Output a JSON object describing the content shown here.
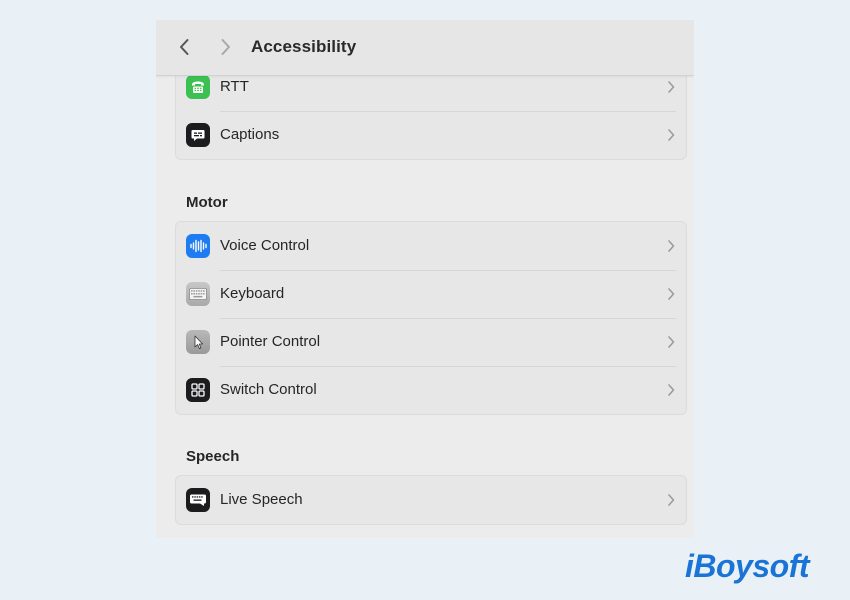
{
  "window": {
    "title": "Accessibility"
  },
  "groups": {
    "hearing": {
      "items": [
        {
          "label": "RTT",
          "icon": "tty-phone-icon"
        },
        {
          "label": "Captions",
          "icon": "captions-bubble-icon"
        }
      ]
    },
    "motor": {
      "header": "Motor",
      "items": [
        {
          "label": "Voice Control",
          "icon": "voice-waveform-icon"
        },
        {
          "label": "Keyboard",
          "icon": "keyboard-icon"
        },
        {
          "label": "Pointer Control",
          "icon": "pointer-arrow-icon"
        },
        {
          "label": "Switch Control",
          "icon": "switch-grid-icon"
        }
      ]
    },
    "speech": {
      "header": "Speech",
      "items": [
        {
          "label": "Live Speech",
          "icon": "live-speech-keyboard-icon"
        }
      ]
    }
  },
  "watermark": {
    "text": "iBoysoft"
  },
  "colors": {
    "rtt_icon": "#3cc052",
    "voice_control_icon": "#1e7cf2",
    "watermark": "#1a74d6"
  }
}
